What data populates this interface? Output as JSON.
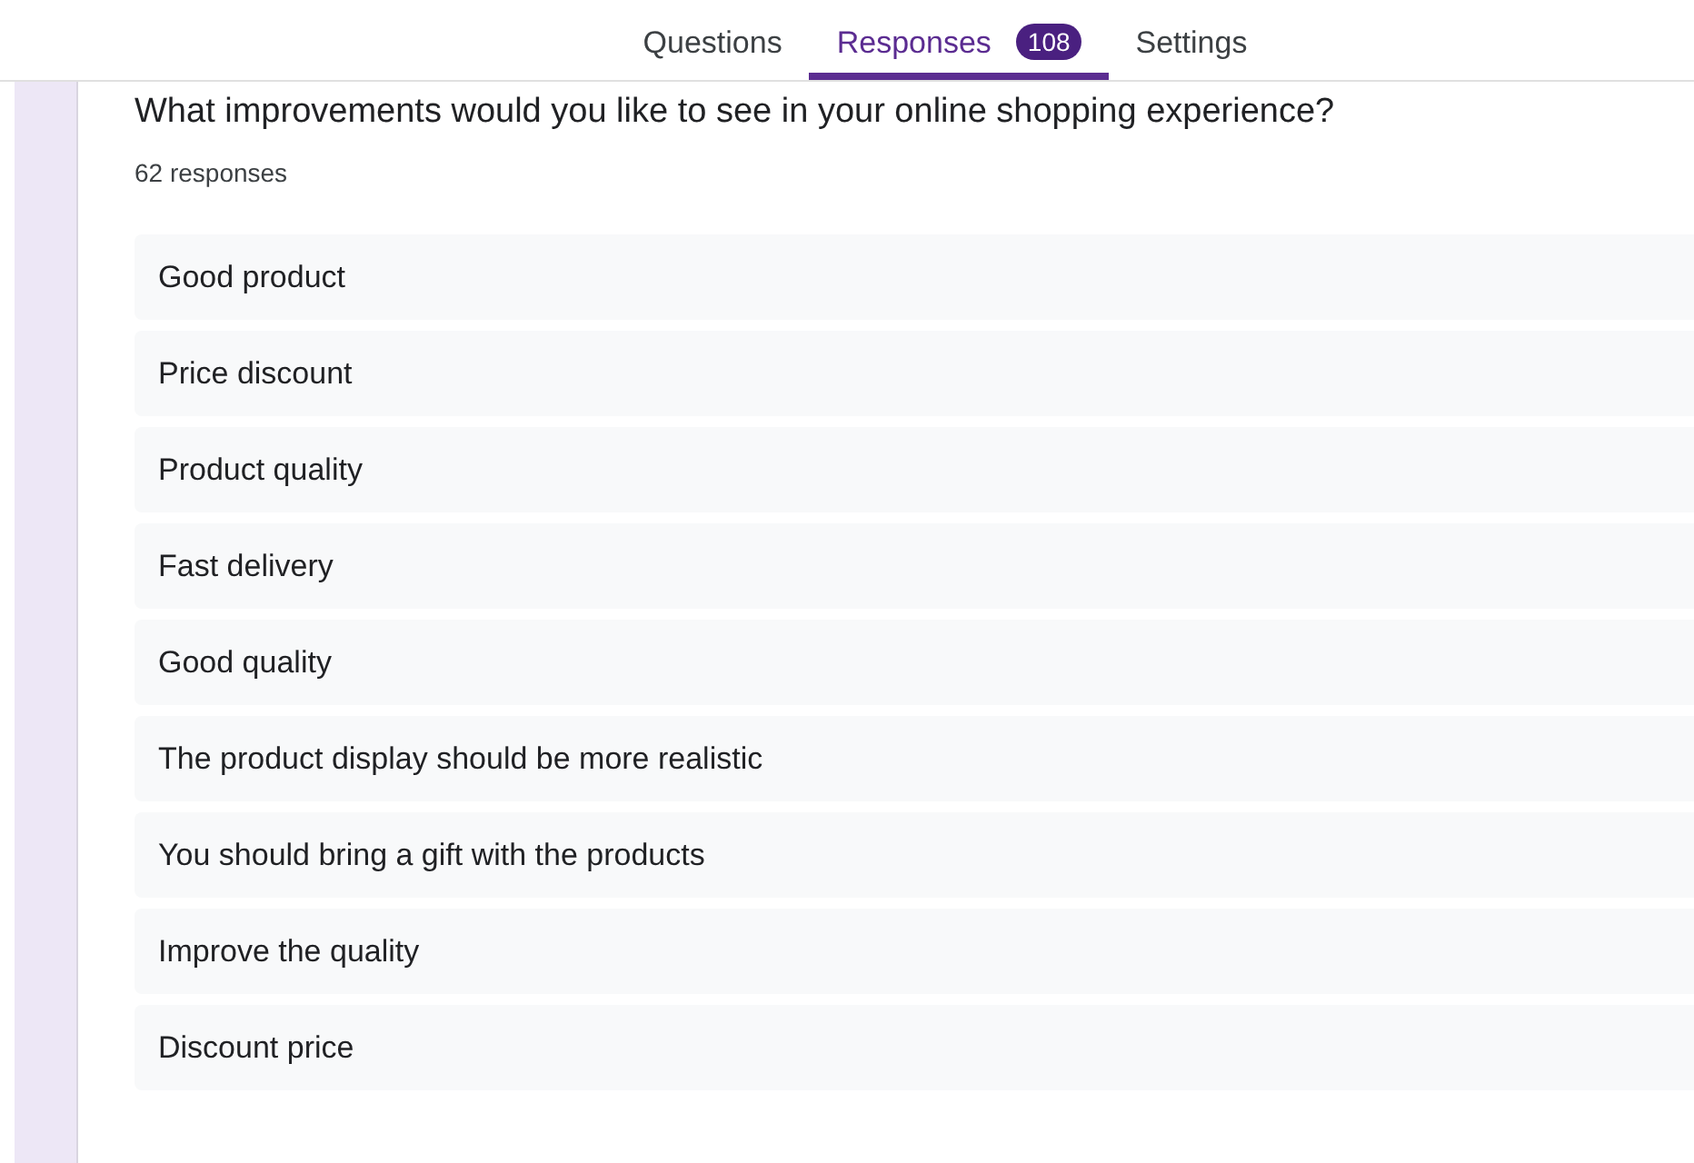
{
  "tabs": [
    {
      "label": "Questions",
      "selected": false
    },
    {
      "label": "Responses",
      "selected": true,
      "badge": "108"
    },
    {
      "label": "Settings",
      "selected": false
    }
  ],
  "question": {
    "title": "What improvements would you like to see in your online shopping experience?",
    "count": "62 responses",
    "answers": [
      "Good product",
      "Price discount",
      "Product quality",
      "Fast delivery",
      "Good quality",
      "The product display should be more realistic",
      "You should bring a gift with the products",
      "Improve the quality",
      "Discount price"
    ]
  }
}
